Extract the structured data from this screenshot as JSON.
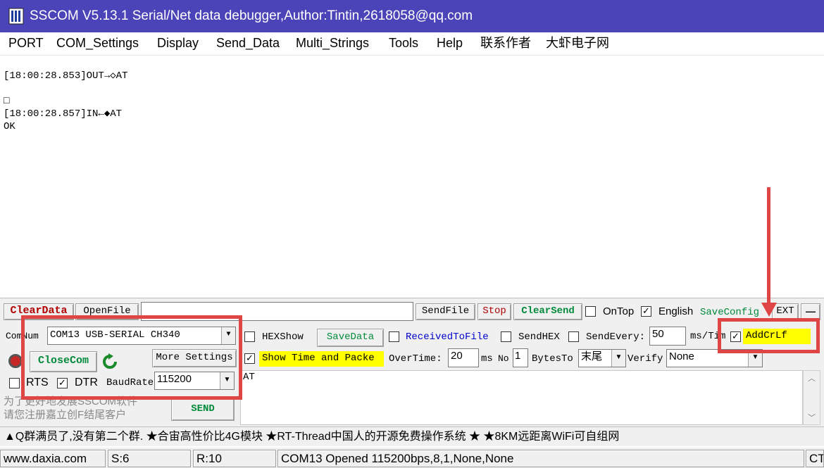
{
  "window": {
    "title": "SSCOM V5.13.1 Serial/Net data debugger,Author:Tintin,2618058@qq.com"
  },
  "menu": [
    "PORT",
    "COM_Settings",
    "Display",
    "Send_Data",
    "Multi_Strings",
    "Tools",
    "Help",
    "联系作者",
    "大虾电子网"
  ],
  "output": {
    "lines": [
      "[18:00:28.853]OUT→◇AT",
      "□",
      "[18:00:28.857]IN←◆AT",
      "OK"
    ]
  },
  "toolbar": {
    "clear_data": "ClearData",
    "open_file": "OpenFile",
    "file_path": "",
    "send_file": "SendFile",
    "stop": "Stop",
    "clear_send": "ClearSend",
    "ontop": "OnTop",
    "english": "English",
    "save_config": "SaveConfig",
    "ext": "EXT",
    "collapse": "—"
  },
  "port": {
    "com_num_label": "ComNum",
    "com_num_value": "COM13 USB-SERIAL CH340",
    "close_com": "CloseCom",
    "more_settings": "More Settings",
    "rts": "RTS",
    "dtr": "DTR",
    "baud_label": "BaudRate",
    "baud_value": "115200"
  },
  "options": {
    "hex_show": "HEXShow",
    "save_data": "SaveData",
    "received_to_file": "ReceivedToFile",
    "send_hex": "SendHEX",
    "send_every": "SendEvery:",
    "send_every_value": "50",
    "ms_tim": "ms/Tim",
    "add_crlf": "AddCrLf",
    "show_time": "Show Time and Packe",
    "overtime_label": "OverTime:",
    "overtime_value": "20",
    "ms": "ms",
    "no_label": "No",
    "no_value": "1",
    "bytes_to": "BytesTo",
    "bytes_to_value": "末尾",
    "verify_label": "Verify",
    "verify_value": "None"
  },
  "send": {
    "text": "AT",
    "button": "SEND",
    "promo_line1": "为了更好地发展SSCOM软件",
    "promo_line2": "请您注册嘉立创F结尾客户"
  },
  "ticker": "▲Q群满员了,没有第二个群. ★合宙高性价比4G模块 ★RT-Thread中国人的开源免费操作系统 ★ ★8KM远距离WiFi可自组网",
  "status": {
    "website": "www.daxia.com",
    "sent": "S:6",
    "received": "R:10",
    "port_state": "COM13 Opened  115200bps,8,1,None,None",
    "cts": "CT"
  },
  "colors": {
    "title_bar": "#4b43b8",
    "highlight": "#ffff00",
    "annotation": "#e04545",
    "red_text": "#b00000",
    "green_text": "#008a3a",
    "blue_text": "#0000cc"
  }
}
